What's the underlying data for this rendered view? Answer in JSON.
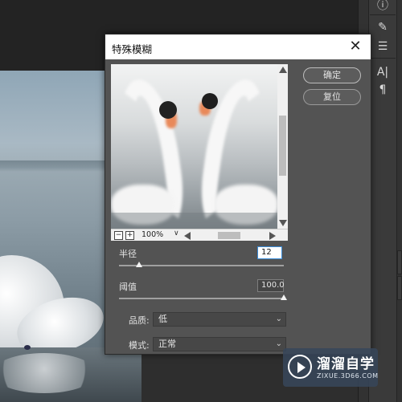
{
  "dialog": {
    "title": "特殊模糊",
    "close_icon": "close-icon",
    "ok_label": "确定",
    "reset_label": "复位"
  },
  "preview": {
    "zoom": "100%",
    "zoom_caret": "∨",
    "zoom_out": "−",
    "zoom_in": "+"
  },
  "params": {
    "radius_label": "半径",
    "radius_value": "12",
    "radius_level": 0.12,
    "threshold_label": "阈值",
    "threshold_value": "100.0",
    "threshold_level": 1.0,
    "quality_label": "品质:",
    "quality_value": "低",
    "mode_label": "模式:",
    "mode_value": "正常"
  },
  "toolbar": {
    "icons": [
      "info-icon",
      "brush-icon",
      "sliders-icon",
      "character-icon",
      "paragraph-icon"
    ],
    "info_glyph": "ⓘ",
    "brush_glyph": "✎",
    "sliders_glyph": "☰",
    "char_glyph": "A|",
    "para_glyph": "¶"
  },
  "watermark": {
    "name": "溜溜自学",
    "url": "ZIXUE.3D66.COM"
  },
  "colors": {
    "dialog_bg": "#535353",
    "active_input_border": "#3b8cd8"
  }
}
